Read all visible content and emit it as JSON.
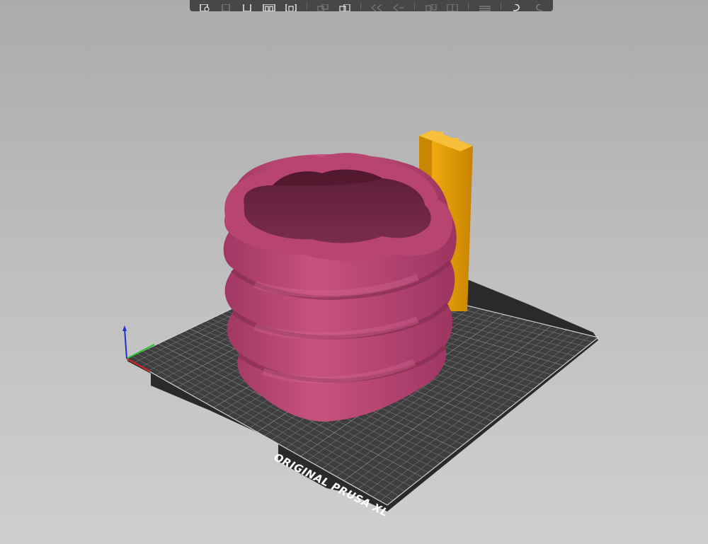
{
  "app": {
    "view": "3D plater",
    "printer": "Original Prusa XL"
  },
  "toolbar": {
    "buttons": [
      {
        "icon": "add-icon",
        "enabled": true
      },
      {
        "icon": "delete-icon",
        "enabled": false
      },
      {
        "icon": "delete-all-icon",
        "enabled": true
      },
      {
        "icon": "arrange-icon",
        "enabled": true
      },
      {
        "icon": "arrange-selection-icon",
        "enabled": true
      },
      {
        "icon": "copy-icon",
        "enabled": false
      },
      {
        "icon": "paste-icon",
        "enabled": true
      },
      {
        "icon": "add-instance-icon",
        "enabled": false
      },
      {
        "icon": "remove-instance-icon",
        "enabled": false
      },
      {
        "icon": "split-objects-icon",
        "enabled": false
      },
      {
        "icon": "split-parts-icon",
        "enabled": false
      },
      {
        "icon": "layers-editing-icon",
        "enabled": false
      },
      {
        "icon": "undo-icon",
        "enabled": true
      },
      {
        "icon": "redo-icon",
        "enabled": false
      }
    ]
  },
  "scene": {
    "bed_label": "ORIGINAL PRUSA XL",
    "objects": [
      {
        "name": "cup",
        "color": "#b84470"
      },
      {
        "name": "wipe-tower",
        "color": "#e29a05"
      }
    ],
    "colors": {
      "bed": "#3e3e3e",
      "bed_edge": "#2a2a2a",
      "grid": "#8a8a8a",
      "axis_x": "#e02020",
      "axis_y": "#20c020",
      "axis_z": "#2030d0"
    }
  }
}
